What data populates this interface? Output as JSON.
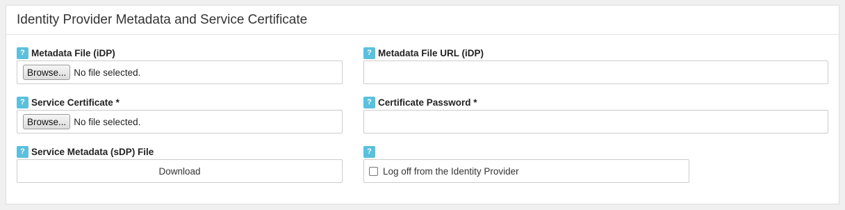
{
  "panel": {
    "title": "Identity Provider Metadata and Service Certificate"
  },
  "help_icon_glyph": "?",
  "fields": {
    "metadata_file": {
      "label": "Metadata File (iDP)",
      "browse_label": "Browse...",
      "status": "No file selected."
    },
    "metadata_file_url": {
      "label": "Metadata File URL (iDP)",
      "value": ""
    },
    "service_certificate": {
      "label": "Service Certificate *",
      "browse_label": "Browse...",
      "status": "No file selected."
    },
    "certificate_password": {
      "label": "Certificate Password *",
      "value": ""
    },
    "service_metadata": {
      "label": "Service Metadata (sDP) File",
      "button_label": "Download"
    },
    "logoff": {
      "label": "",
      "checkbox_label": "Log off from the Identity Provider",
      "checked": false
    }
  },
  "colors": {
    "help_icon": "#5bc0de",
    "border": "#cccccc",
    "background": "#f0f0f0"
  }
}
